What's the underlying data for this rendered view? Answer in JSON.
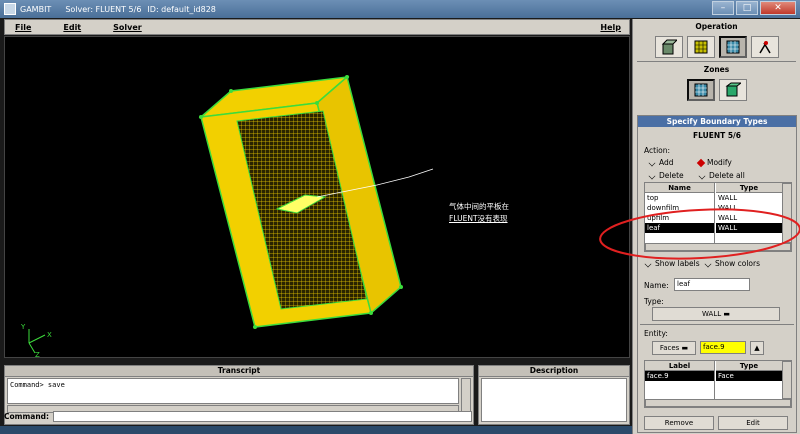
{
  "window": {
    "app": "GAMBIT",
    "solver": "Solver: FLUENT 5/6",
    "id": "ID: default_id828"
  },
  "menu": {
    "file": "File",
    "edit": "Edit",
    "solver": "Solver",
    "help": "Help"
  },
  "viewport": {
    "annotation_line1": "气体中间的平板在",
    "annotation_line2": "FLUENT没有表现",
    "axis_x": "X",
    "axis_y": "Y",
    "axis_z": "Z"
  },
  "transcript": {
    "title": "Transcript",
    "line": "Command> save"
  },
  "description": {
    "title": "Description"
  },
  "command": {
    "label": "Command:",
    "value": ""
  },
  "operation": {
    "title": "Operation"
  },
  "zones": {
    "title": "Zones"
  },
  "spec": {
    "header": "Specify Boundary Types",
    "solver": "FLUENT 5/6",
    "action_label": "Action:",
    "add": "Add",
    "modify": "Modify",
    "delete": "Delete",
    "delete_all": "Delete all",
    "col_name": "Name",
    "col_type": "Type",
    "rows": [
      {
        "name": "top",
        "type": "WALL"
      },
      {
        "name": "downfilm",
        "type": "WALL"
      },
      {
        "name": "upfilm",
        "type": "WALL"
      },
      {
        "name": "leaf",
        "type": "WALL"
      }
    ],
    "show_labels": "Show labels",
    "show_colors": "Show colors",
    "name_label": "Name:",
    "name_value": "leaf",
    "type_label": "Type:",
    "type_value": "WALL",
    "entity_label": "Entity:",
    "entity_value": "Faces",
    "entity_pick": "face.9",
    "col_label": "Label",
    "entity_rows": [
      {
        "label": "face.9",
        "type": "Face"
      }
    ],
    "remove": "Remove",
    "edit": "Edit"
  },
  "colors": {
    "mesh": "#f2d000",
    "edge": "#3cdc3c",
    "accent": "#4a6fa5",
    "annot_circle": "#e02020"
  }
}
